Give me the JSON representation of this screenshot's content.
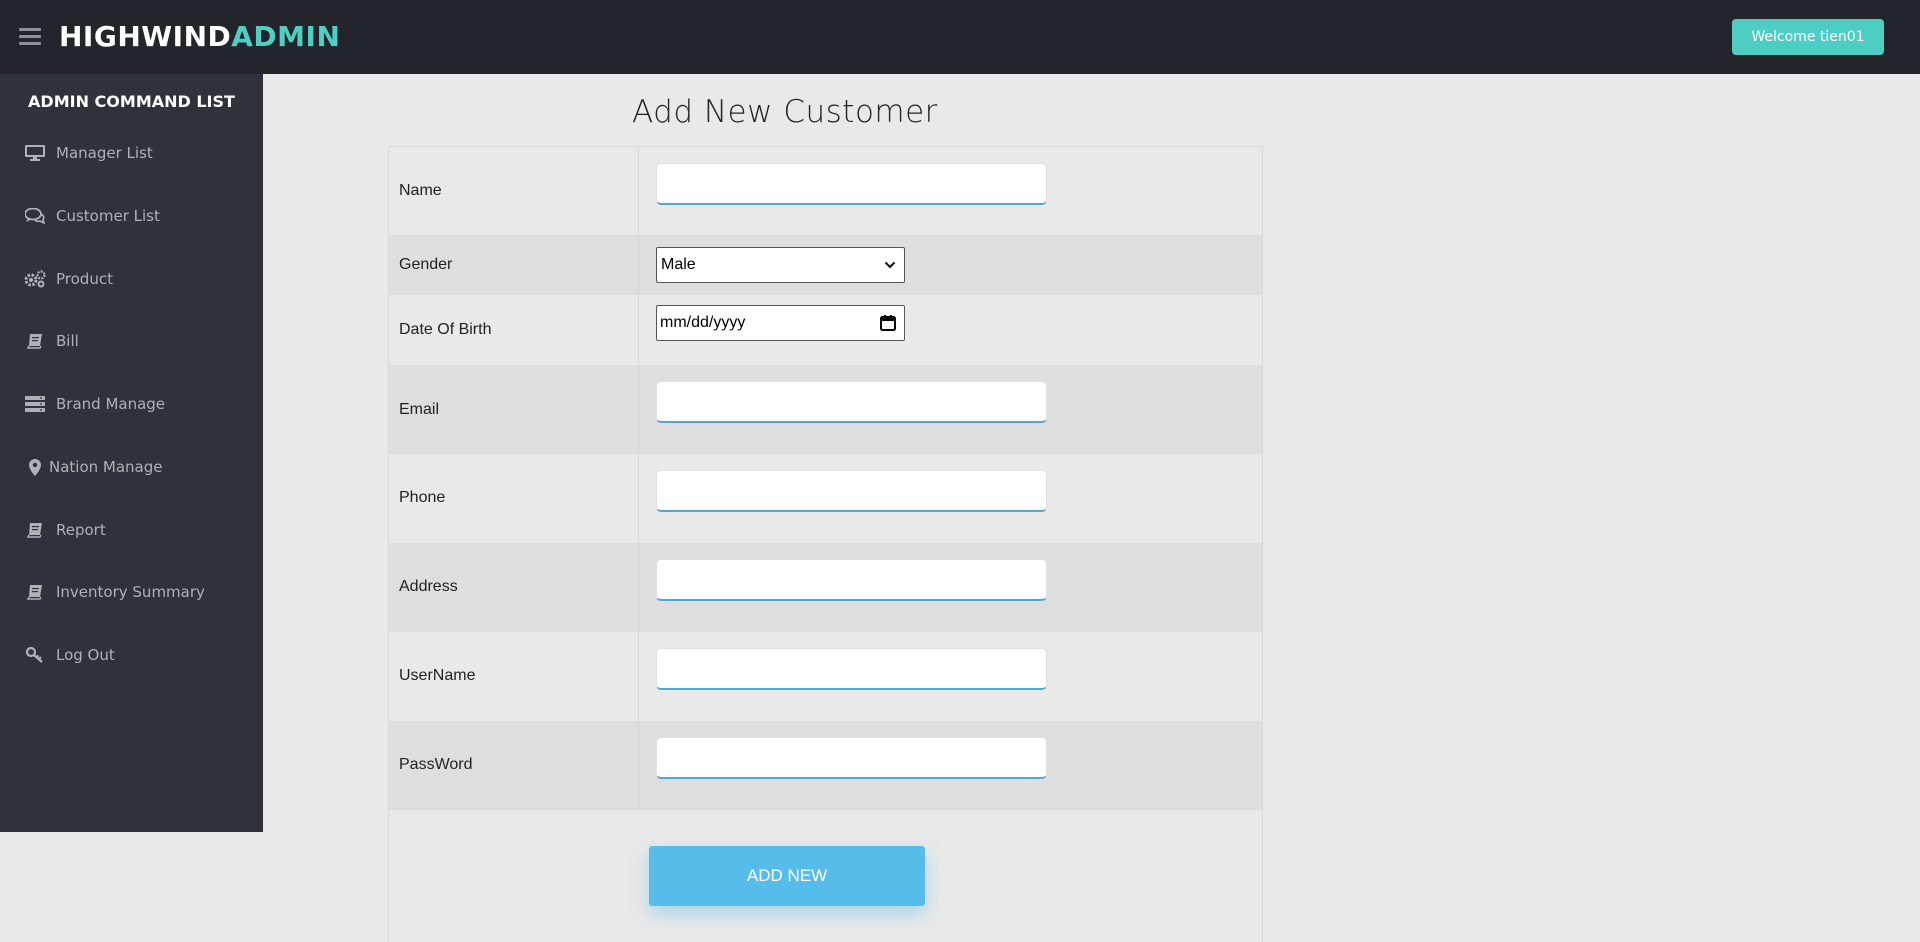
{
  "header": {
    "brand_part1": "HIGHWIND",
    "brand_part2": "ADMIN",
    "welcome_label": "Welcome tien01",
    "accent_color": "#4ecdc4"
  },
  "sidebar": {
    "title": "ADMIN COMMAND LIST",
    "items": [
      {
        "label": "Manager List",
        "icon": "desktop-icon"
      },
      {
        "label": "Customer List",
        "icon": "comments-icon"
      },
      {
        "label": "Product",
        "icon": "cogs-icon"
      },
      {
        "label": "Bill",
        "icon": "book-icon"
      },
      {
        "label": "Brand Manage",
        "icon": "server-icon"
      },
      {
        "label": "Nation Manage",
        "icon": "map-marker-icon"
      },
      {
        "label": "Report",
        "icon": "book-icon"
      },
      {
        "label": "Inventory Summary",
        "icon": "book-icon"
      },
      {
        "label": "Log Out",
        "icon": "key-icon"
      }
    ]
  },
  "form": {
    "title": "Add New Customer",
    "fields": {
      "name": {
        "label": "Name",
        "value": ""
      },
      "gender": {
        "label": "Gender",
        "value": "Male"
      },
      "dob": {
        "label": "Date Of Birth",
        "placeholder": "mm/dd/yyyy"
      },
      "email": {
        "label": "Email",
        "value": ""
      },
      "phone": {
        "label": "Phone",
        "value": ""
      },
      "address": {
        "label": "Address",
        "value": ""
      },
      "username": {
        "label": "UserName",
        "value": ""
      },
      "password": {
        "label": "PassWord",
        "value": ""
      }
    },
    "submit_label": "ADD NEW",
    "submit_color": "#56bdeb"
  }
}
